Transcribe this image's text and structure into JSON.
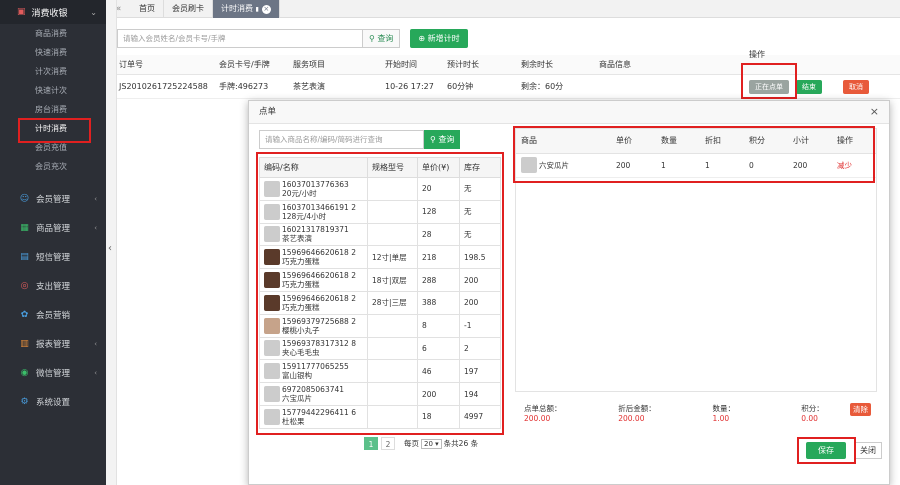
{
  "sidebar": {
    "top_label": "消费收银",
    "sub_items": [
      "商品消费",
      "快速消费",
      "计次消费",
      "快速计次",
      "房台消费",
      "计时消费",
      "会员充值",
      "会员充次"
    ],
    "items": [
      {
        "label": "会员管理",
        "icon": "users-icon"
      },
      {
        "label": "商品管理",
        "icon": "box-icon"
      },
      {
        "label": "短信管理",
        "icon": "sms-icon"
      },
      {
        "label": "支出管理",
        "icon": "money-icon"
      },
      {
        "label": "会员营销",
        "icon": "gift-icon"
      },
      {
        "label": "报表管理",
        "icon": "report-icon"
      },
      {
        "label": "微信管理",
        "icon": "wechat-icon"
      },
      {
        "label": "系统设置",
        "icon": "gear-icon"
      }
    ]
  },
  "tabs": [
    "首页",
    "会员刷卡",
    "计时消费"
  ],
  "main": {
    "search_placeholder": "请输入会员姓名/会员卡号/手牌",
    "search_btn": "查询",
    "add_btn": "新增计时",
    "columns": [
      "订单号",
      "会员卡号/手牌",
      "服务项目",
      "开始时间",
      "预计时长",
      "剩余时长",
      "商品信息",
      "操作"
    ],
    "row": {
      "order": "JS2010261725224588",
      "card": "手牌:496273",
      "service": "茶艺表演",
      "start": "10-26 17:27",
      "duration": "60分钟",
      "remaining": "剩余：60分",
      "ops": [
        "正在点单",
        "结束",
        "取消"
      ]
    }
  },
  "modal": {
    "title": "点单",
    "search_placeholder": "请输入商品名称/编码/简码进行查询",
    "search_btn": "查询",
    "product_columns": [
      "编码/名称",
      "规格型号",
      "单价(¥)",
      "库存"
    ],
    "products": [
      {
        "code": "16037013776363",
        "name": "20元/小时",
        "spec": "",
        "price": "20",
        "stock": "无"
      },
      {
        "code": "16037013466191 2",
        "name": "128元/4小时",
        "spec": "",
        "price": "128",
        "stock": "无"
      },
      {
        "code": "16021317819371",
        "name": "茶艺表演",
        "spec": "",
        "price": "28",
        "stock": "无"
      },
      {
        "code": "15969646620618 2",
        "name": "巧克力蛋糕",
        "spec": "12寸|单层",
        "price": "218",
        "stock": "198.5"
      },
      {
        "code": "15969646620618 2",
        "name": "巧克力蛋糕",
        "spec": "18寸|双层",
        "price": "288",
        "stock": "200"
      },
      {
        "code": "15969646620618 2",
        "name": "巧克力蛋糕",
        "spec": "28寸|三层",
        "price": "388",
        "stock": "200"
      },
      {
        "code": "15969379725688 2",
        "name": "樱桃小丸子",
        "spec": "",
        "price": "8",
        "stock": "-1"
      },
      {
        "code": "15969378317312 8",
        "name": "夹心毛毛虫",
        "spec": "",
        "price": "6",
        "stock": "2"
      },
      {
        "code": "15911777065255",
        "name": "富山银构",
        "spec": "",
        "price": "46",
        "stock": "197"
      },
      {
        "code": "6972085063741",
        "name": "六宝瓜片",
        "spec": "",
        "price": "200",
        "stock": "194"
      },
      {
        "code": "15779442296411 6",
        "name": "杜松果",
        "spec": "",
        "price": "18",
        "stock": "4997"
      }
    ],
    "pager": {
      "pages": [
        "1",
        "2"
      ],
      "per_page_prefix": "每页",
      "per_page": "20",
      "suffix": "条共26 条"
    },
    "cart_columns": [
      "商品",
      "单价",
      "数量",
      "折扣",
      "积分",
      "小计",
      "操作"
    ],
    "cart": [
      {
        "name": "六安瓜片",
        "price": "200",
        "qty": "1",
        "discount": "1",
        "points": "0",
        "subtotal": "200",
        "op": "减少"
      }
    ],
    "summary": {
      "total_label": "点单总额：",
      "total": "200.00",
      "disc_label": "折后金额：",
      "disc": "200.00",
      "qty_label": "数量：",
      "qty": "1.00",
      "pts_label": "积分：",
      "pts": "0.00"
    },
    "clear_btn": "清除",
    "save_btn": "保存",
    "close_btn": "关闭"
  }
}
